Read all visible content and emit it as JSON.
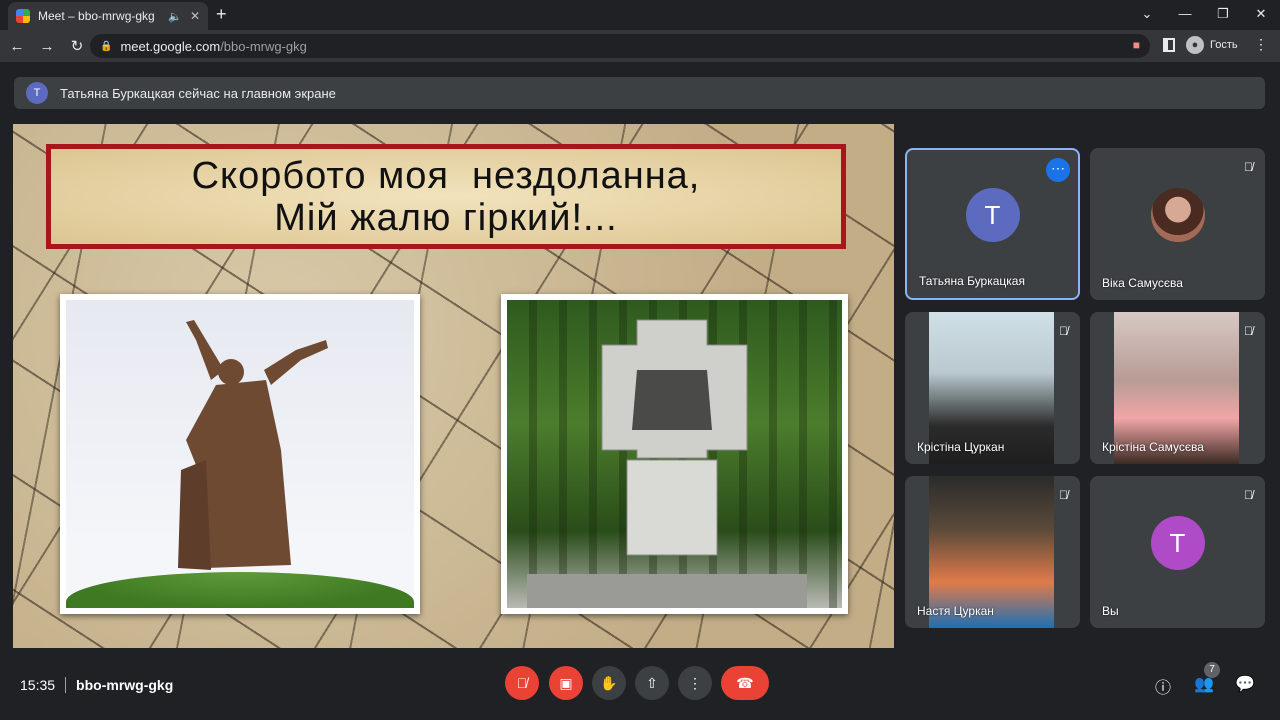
{
  "browser": {
    "tab_title": "Meet – bbo-mrwg-gkg",
    "url_host": "meet.google.com",
    "url_path": "/bbo-mrwg-gkg",
    "profile_label": "Гость",
    "new_tab_icon": "plus-icon",
    "window_controls": [
      "minimize-icon",
      "maximize-icon",
      "close-icon"
    ]
  },
  "banner": {
    "avatar_letter": "Т",
    "text": "Татьяна Буркацкая сейчас на главном экране"
  },
  "presentation": {
    "title_line1": "Скорбото моя  нездоланна,",
    "title_line2": "Мій жалю гіркий!...",
    "frame_color": "#a8161c"
  },
  "participants": [
    {
      "name": "Татьяна Буркацкая",
      "avatar_letter": "Т",
      "avatar_color": "#5c6bc0",
      "type": "avatar",
      "active": true
    },
    {
      "name": "Віка Самусєва",
      "type": "photo",
      "muted": true
    },
    {
      "name": "Крістіна Цуркан",
      "type": "video",
      "muted": true
    },
    {
      "name": "Крістіна Самусєва",
      "type": "video",
      "muted": true
    },
    {
      "name": "Настя Цуркан",
      "type": "video",
      "muted": true
    },
    {
      "name": "Вы",
      "avatar_letter": "Т",
      "avatar_color": "#b04bc8",
      "type": "avatar",
      "muted": true
    }
  ],
  "bottom": {
    "time": "15:35",
    "meeting_code": "bbo-mrwg-gkg",
    "people_count": "7",
    "controls": [
      "mic-off-icon",
      "camera-off-icon",
      "raise-hand-icon",
      "present-icon",
      "more-options-icon",
      "leave-call-icon"
    ],
    "right_icons": [
      "info-icon",
      "people-icon",
      "chat-icon"
    ]
  }
}
